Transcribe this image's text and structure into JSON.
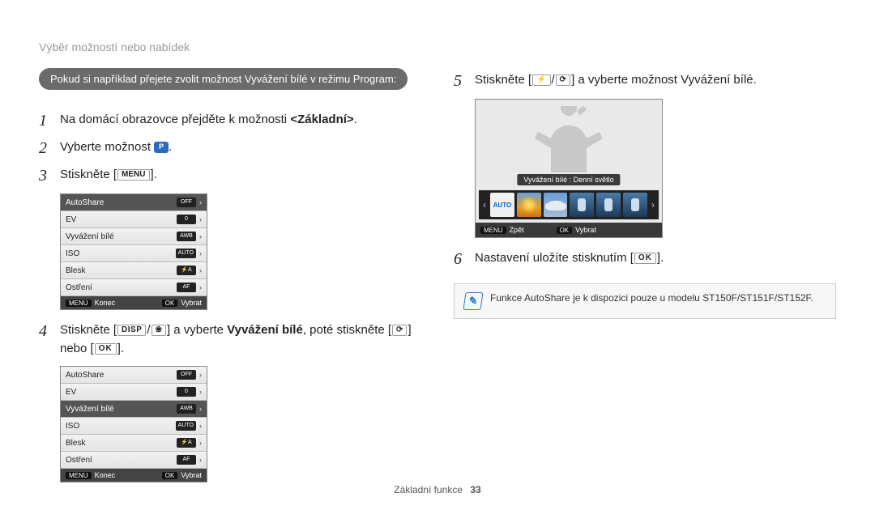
{
  "header": {
    "title": "Výběr možností nebo nabídek"
  },
  "callout": "Pokud si například přejete zvolit možnost Vyvážení bílé v režimu Program:",
  "steps": {
    "s1": {
      "num": "1",
      "pre": "Na domácí obrazovce přejděte k možnosti ",
      "bold": "<Základní>",
      "post": "."
    },
    "s2": {
      "num": "2",
      "text": "Vyberte možnost "
    },
    "s3": {
      "num": "3",
      "pre": "Stiskněte [",
      "btn": "MENU",
      "post": "]."
    },
    "s4": {
      "num": "4",
      "pre": "Stiskněte [",
      "btn1": "DISP",
      "slash": "/",
      "mid": "] a vyberte ",
      "bold": "Vyvážení bílé",
      "post1": ", poté stiskněte [",
      "post2": "] nebo [",
      "btn3": "OK",
      "post3": "]."
    },
    "s5": {
      "num": "5",
      "pre": "Stiskněte [",
      "slash": "/",
      "post": "] a vyberte možnost Vyvážení bílé."
    },
    "s6": {
      "num": "6",
      "pre": "Nastavení uložíte stisknutím [",
      "btn": "OK",
      "post": "]."
    }
  },
  "menu_labels": {
    "AutoShare": "AutoShare",
    "EV": "EV",
    "WB": "Vyvážení bílé",
    "ISO": "ISO",
    "Flash": "Blesk",
    "Focus": "Ostření"
  },
  "menu_values": {
    "AutoShare": "OFF",
    "EV": "0",
    "WB": "AWB",
    "ISO": "AUTO",
    "Flash": "A",
    "Focus": "AF"
  },
  "menu_foot": {
    "menu": "MENU",
    "left": "Konec",
    "ok": "OK",
    "right": "Vybrat"
  },
  "preview": {
    "wb_label": "Vyvážení bílé : Denní světlo",
    "auto_text": "AUTO",
    "foot_menu": "MENU",
    "foot_left": "Zpět",
    "foot_ok": "OK",
    "foot_right": "Vybrat"
  },
  "note": {
    "text": "Funkce AutoShare je k dispozici pouze u modelu ST150F/ST151F/ST152F."
  },
  "footer": {
    "section": "Základní funkce",
    "page": "33"
  },
  "icons": {
    "prog": "P",
    "flower": "❀",
    "flash": "⚡",
    "timer": "⟳"
  }
}
